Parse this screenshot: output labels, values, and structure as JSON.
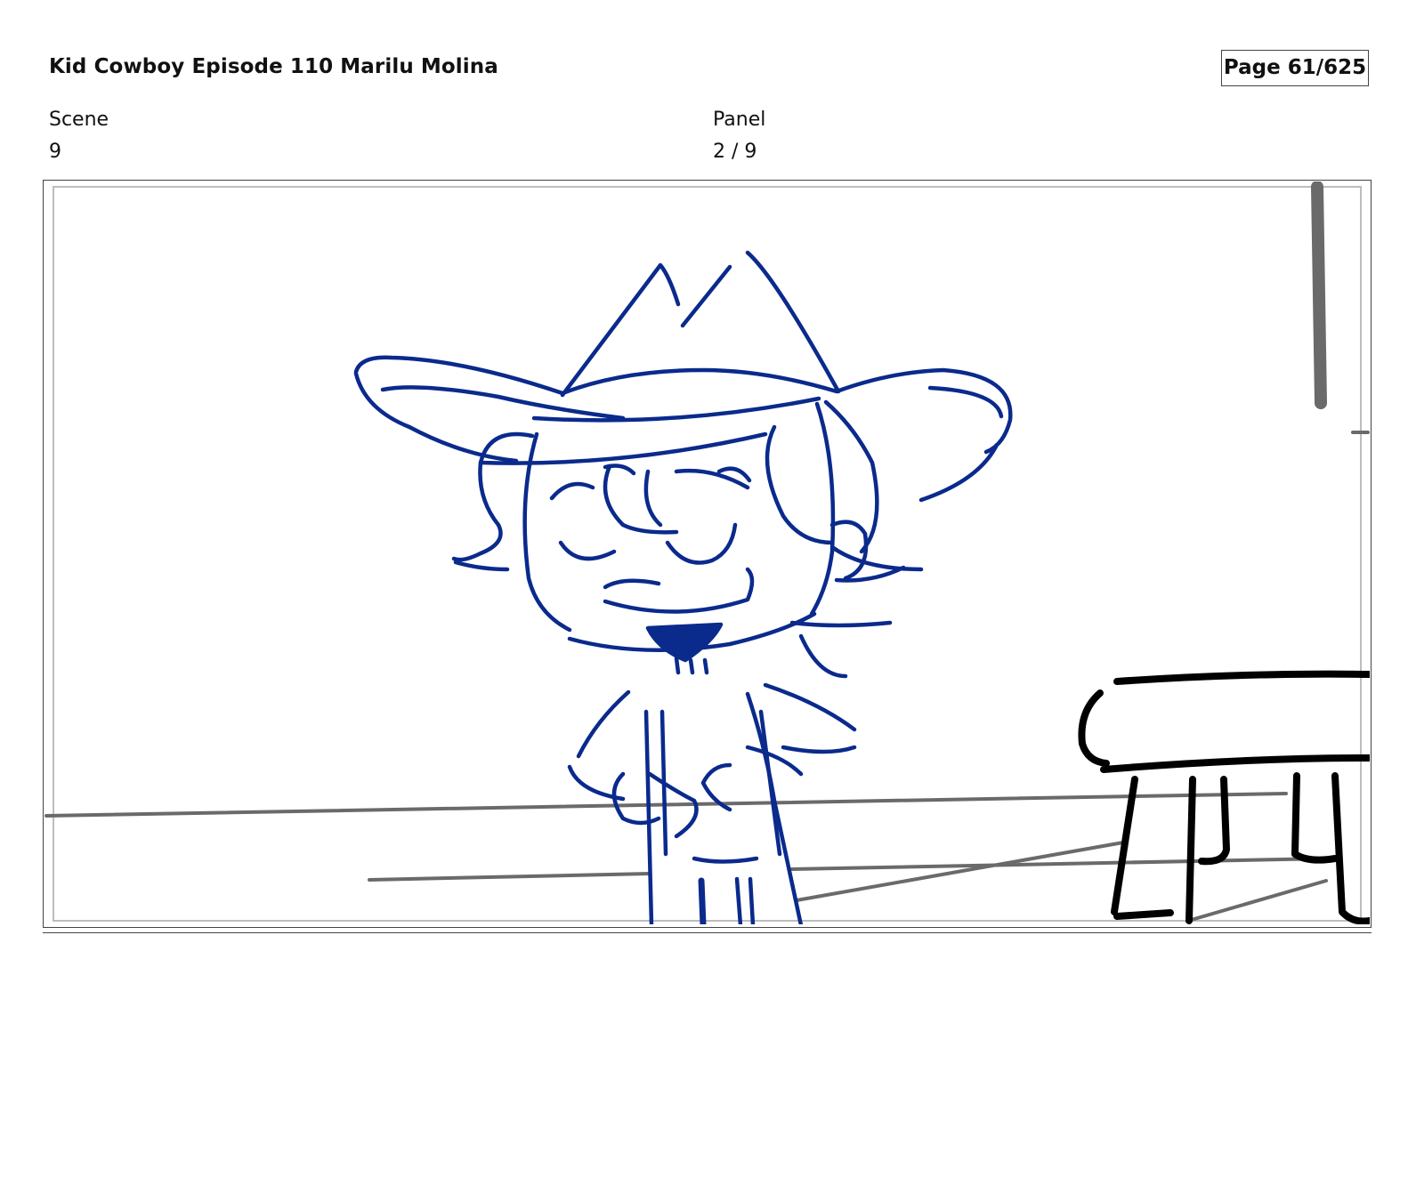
{
  "header": {
    "title": "Kid Cowboy Episode 110 Marilu Molina",
    "page": "Page  61/625"
  },
  "meta": {
    "scene_label": "Scene",
    "scene_value": "9",
    "panel_label": "Panel",
    "panel_value": "2 / 9"
  },
  "colors": {
    "sketch_blue": "#0a2a8c",
    "background_gray": "#6a6a6a",
    "stool_black": "#000000"
  }
}
